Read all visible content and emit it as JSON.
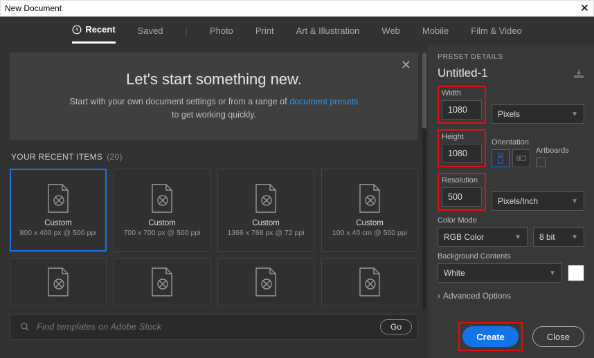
{
  "window": {
    "title": "New Document"
  },
  "tabs": {
    "recent": "Recent",
    "saved": "Saved",
    "photo": "Photo",
    "print": "Print",
    "art": "Art & Illustration",
    "web": "Web",
    "mobile": "Mobile",
    "film": "Film & Video"
  },
  "welcome": {
    "heading": "Let's start something new.",
    "line1a": "Start with your own document settings or from a range of ",
    "link": "document presets",
    "line2": "to get working quickly."
  },
  "recents": {
    "label": "YOUR RECENT ITEMS",
    "count": "(20)",
    "items": [
      {
        "title": "Custom",
        "sub": "800 x 400 px @ 500 ppi"
      },
      {
        "title": "Custom",
        "sub": "700 x 700 px @ 500 ppi"
      },
      {
        "title": "Custom",
        "sub": "1366 x 768 px @ 72 ppi"
      },
      {
        "title": "Custom",
        "sub": "100 x 40 cm @ 500 ppi"
      }
    ]
  },
  "search": {
    "placeholder": "Find templates on Adobe Stock",
    "go": "Go"
  },
  "details": {
    "header": "PRESET DETAILS",
    "name": "Untitled-1",
    "width_label": "Width",
    "width_value": "1080",
    "width_unit": "Pixels",
    "height_label": "Height",
    "height_value": "1080",
    "orientation_label": "Orientation",
    "artboards_label": "Artboards",
    "resolution_label": "Resolution",
    "resolution_value": "500",
    "resolution_unit": "Pixels/Inch",
    "colormode_label": "Color Mode",
    "colormode_value": "RGB Color",
    "colordepth_value": "8 bit",
    "bgcontents_label": "Background Contents",
    "bgcontents_value": "White",
    "advanced": "Advanced Options",
    "btn_create": "Create",
    "btn_close": "Close"
  }
}
